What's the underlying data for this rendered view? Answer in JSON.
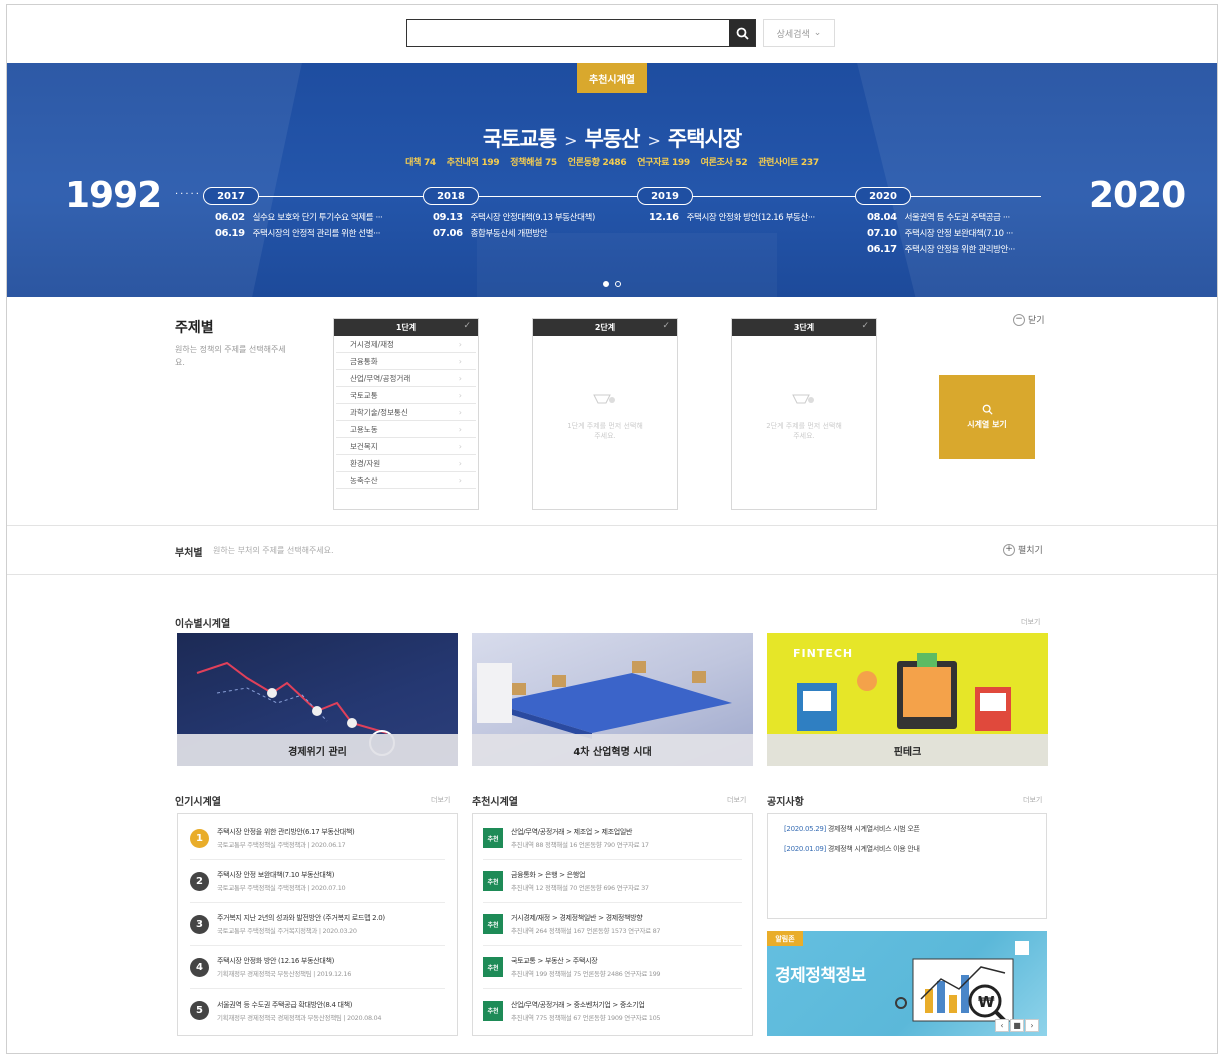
{
  "search": {
    "value": "",
    "advanced_label": "상세검색"
  },
  "banner": {
    "tag": "추천시계열",
    "path": [
      "국토교통",
      "부동산",
      "주택시장"
    ],
    "stats": [
      "대책 74",
      "추진내역 199",
      "정책해설 75",
      "언론동향 2486",
      "연구자료 199",
      "여론조사 52",
      "관련사이트 237"
    ],
    "year_start": "1992",
    "year_end": "2020",
    "timeline": [
      {
        "year": "2017",
        "events": [
          {
            "date": "06.02",
            "text": "실수요 보호와 단기 투기수요 억제를 ···"
          },
          {
            "date": "06.19",
            "text": "주택시장의 안정적 관리를 위한 선별···"
          }
        ]
      },
      {
        "year": "2018",
        "events": [
          {
            "date": "09.13",
            "text": "주택시장 안정대책(9.13 부동산대책)"
          },
          {
            "date": "07.06",
            "text": "종합부동산세 개편방안"
          }
        ]
      },
      {
        "year": "2019",
        "events": [
          {
            "date": "12.16",
            "text": "주택시장 안정화 방안(12.16 부동산···"
          }
        ]
      },
      {
        "year": "2020",
        "events": [
          {
            "date": "08.04",
            "text": "서울권역 등 수도권 주택공급 ···"
          },
          {
            "date": "07.10",
            "text": "주택시장 안정 보완대책(7.10 ···"
          },
          {
            "date": "06.17",
            "text": "주택시장 안정을 위한 관리방안···"
          }
        ]
      }
    ]
  },
  "subject": {
    "title": "주제별",
    "desc": "원하는 정책의 주제를 선택해주세요.",
    "close_label": "닫기",
    "col1": {
      "head": "1단계",
      "items": [
        "거시경제/재정",
        "금융통화",
        "산업/무역/공정거래",
        "국토교통",
        "과학기술/정보통신",
        "고용노동",
        "보건복지",
        "환경/자원",
        "농축수산"
      ]
    },
    "col2": {
      "head": "2단계",
      "placeholder": "1단계 주제를 먼저 선택해 주세요."
    },
    "col3": {
      "head": "3단계",
      "placeholder": "2단계 주제를 먼저 선택해 주세요."
    },
    "view_button": "시계열 보기"
  },
  "dept": {
    "title": "부처별",
    "desc": "원하는 부처의 주제를 선택해주세요.",
    "expand_label": "펼치기"
  },
  "issues": {
    "title": "이슈별시계열",
    "more": "더보기",
    "cards": [
      "경제위기 관리",
      "4차 산업혁명 시대",
      "핀테크"
    ],
    "fintech_word": "FINTECH"
  },
  "popular": {
    "title": "인기시계열",
    "more": "더보기",
    "items": [
      {
        "num": "1",
        "title": "주택시장 안정을 위한 관리방안(6.17 부동산대책)",
        "sub": "국토교통부 주택정책실 주택정책과 | 2020.06.17"
      },
      {
        "num": "2",
        "title": "주택시장 안정 보완대책(7.10 부동산대책)",
        "sub": "국토교통부 주택정책실 주택정책과 | 2020.07.10"
      },
      {
        "num": "3",
        "title": "주거복지 지난 2년의 성과와 발전방안 (주거복지 로드맵 2.0)",
        "sub": "국토교통부 주택정책실 주거복지정책과 | 2020.03.20"
      },
      {
        "num": "4",
        "title": "주택시장 안정화 방안 (12.16 부동산대책)",
        "sub": "기획재정부 경제정책국 부동산정책팀 | 2019.12.16"
      },
      {
        "num": "5",
        "title": "서울권역 등 수도권 주택공급 확대방안(8.4 대책)",
        "sub": "기획재정부 경제정책국 경제정책과 부동산정책팀 | 2020.08.04"
      }
    ]
  },
  "recommend": {
    "title": "추천시계열",
    "more": "더보기",
    "badge": "추천",
    "items": [
      {
        "title": "산업/무역/공정거래 > 제조업 > 제조업일반",
        "sub": "추진내역 88  정책해설 16  언론동향 790  연구자료 17"
      },
      {
        "title": "금융통화 > 은행 > 은행업",
        "sub": "추진내역 12  정책해설 70  언론동향 696  연구자료 37"
      },
      {
        "title": "거시경제/재정 > 경제정책일반 > 경제정책방향",
        "sub": "추진내역 264  정책해설 167  언론동향 1573  연구자료 87"
      },
      {
        "title": "국토교통 > 부동산 > 주택시장",
        "sub": "추진내역 199  정책해설 75  언론동향 2486  연구자료 199"
      },
      {
        "title": "산업/무역/공정거래 > 중소벤처기업 > 중소기업",
        "sub": "추진내역 775  정책해설 67  언론동향 1909  연구자료 105"
      }
    ]
  },
  "notice": {
    "title": "공지사항",
    "more": "더보기",
    "items": [
      {
        "date": "[2020.05.29]",
        "text": "경제정책 시계열서비스 시범 오픈"
      },
      {
        "date": "[2020.01.09]",
        "text": "경제정책 시계열서비스 이용 안내"
      }
    ]
  },
  "eco_banner": {
    "tag": "알림존",
    "title": "경제정책정보",
    "nav": [
      "‹",
      "■",
      "›"
    ]
  },
  "colors": {
    "accent": "#d9a82d",
    "banner_blue": "#2456ab",
    "recommend_green": "#1e8b57",
    "notice_blue": "#3a6fb5"
  }
}
